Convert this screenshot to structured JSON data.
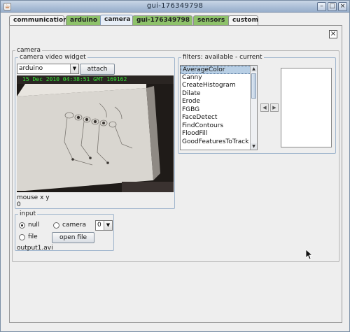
{
  "window": {
    "title": "gui-176349798",
    "app_icon": "java-cup-icon",
    "controls": [
      "minimize-icon",
      "maximize-icon",
      "close-icon"
    ]
  },
  "tabs": [
    {
      "label": "communication",
      "color": "#f5f5f5"
    },
    {
      "label": "arduino",
      "color": "#8ec26a"
    },
    {
      "label": "camera",
      "color": "#e7eef7",
      "selected": true
    },
    {
      "label": "gui-176349798",
      "color": "#8ec26a"
    },
    {
      "label": "sensors",
      "color": "#8ec26a"
    },
    {
      "label": "custom",
      "color": "#f5f5f5"
    }
  ],
  "panel": {
    "heading": "camera",
    "close_glyph": "×"
  },
  "video_widget": {
    "legend": "camera  video widget",
    "source_value": "arduino",
    "attach_label": "attach",
    "timestamp": "15 Dec 2010 04:38:51 GMT 169162",
    "mouse_label": "mouse x y",
    "mouse_value": "0"
  },
  "filters": {
    "legend": "filters: available - current",
    "available": [
      "AverageColor",
      "Canny",
      "CreateHistogram",
      "Dilate",
      "Erode",
      "FGBG",
      "FaceDetect",
      "FindContours",
      "FloodFill",
      "GoodFeaturesToTrack"
    ],
    "selected": "AverageColor",
    "move_left_glyph": "◀",
    "move_right_glyph": "▶"
  },
  "input": {
    "legend": "input",
    "null_label": "null",
    "null_selected": true,
    "camera_label": "camera",
    "camera_index": "0",
    "file_label": "file",
    "open_file_label": "open file",
    "file_name": "output1.avi"
  }
}
